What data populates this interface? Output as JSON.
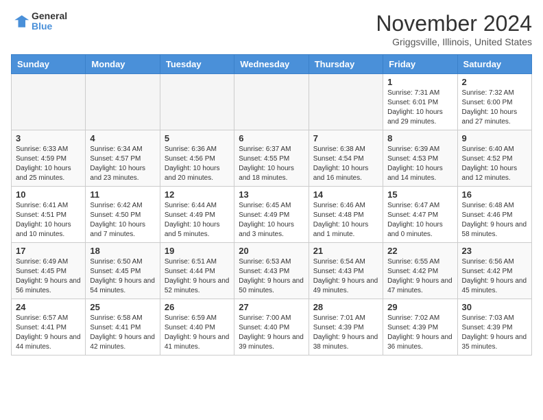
{
  "header": {
    "logo_general": "General",
    "logo_blue": "Blue",
    "month_title": "November 2024",
    "location": "Griggsville, Illinois, United States"
  },
  "weekdays": [
    "Sunday",
    "Monday",
    "Tuesday",
    "Wednesday",
    "Thursday",
    "Friday",
    "Saturday"
  ],
  "weeks": [
    [
      {
        "day": "",
        "info": ""
      },
      {
        "day": "",
        "info": ""
      },
      {
        "day": "",
        "info": ""
      },
      {
        "day": "",
        "info": ""
      },
      {
        "day": "",
        "info": ""
      },
      {
        "day": "1",
        "info": "Sunrise: 7:31 AM\nSunset: 6:01 PM\nDaylight: 10 hours and 29 minutes."
      },
      {
        "day": "2",
        "info": "Sunrise: 7:32 AM\nSunset: 6:00 PM\nDaylight: 10 hours and 27 minutes."
      }
    ],
    [
      {
        "day": "3",
        "info": "Sunrise: 6:33 AM\nSunset: 4:59 PM\nDaylight: 10 hours and 25 minutes."
      },
      {
        "day": "4",
        "info": "Sunrise: 6:34 AM\nSunset: 4:57 PM\nDaylight: 10 hours and 23 minutes."
      },
      {
        "day": "5",
        "info": "Sunrise: 6:36 AM\nSunset: 4:56 PM\nDaylight: 10 hours and 20 minutes."
      },
      {
        "day": "6",
        "info": "Sunrise: 6:37 AM\nSunset: 4:55 PM\nDaylight: 10 hours and 18 minutes."
      },
      {
        "day": "7",
        "info": "Sunrise: 6:38 AM\nSunset: 4:54 PM\nDaylight: 10 hours and 16 minutes."
      },
      {
        "day": "8",
        "info": "Sunrise: 6:39 AM\nSunset: 4:53 PM\nDaylight: 10 hours and 14 minutes."
      },
      {
        "day": "9",
        "info": "Sunrise: 6:40 AM\nSunset: 4:52 PM\nDaylight: 10 hours and 12 minutes."
      }
    ],
    [
      {
        "day": "10",
        "info": "Sunrise: 6:41 AM\nSunset: 4:51 PM\nDaylight: 10 hours and 10 minutes."
      },
      {
        "day": "11",
        "info": "Sunrise: 6:42 AM\nSunset: 4:50 PM\nDaylight: 10 hours and 7 minutes."
      },
      {
        "day": "12",
        "info": "Sunrise: 6:44 AM\nSunset: 4:49 PM\nDaylight: 10 hours and 5 minutes."
      },
      {
        "day": "13",
        "info": "Sunrise: 6:45 AM\nSunset: 4:49 PM\nDaylight: 10 hours and 3 minutes."
      },
      {
        "day": "14",
        "info": "Sunrise: 6:46 AM\nSunset: 4:48 PM\nDaylight: 10 hours and 1 minute."
      },
      {
        "day": "15",
        "info": "Sunrise: 6:47 AM\nSunset: 4:47 PM\nDaylight: 10 hours and 0 minutes."
      },
      {
        "day": "16",
        "info": "Sunrise: 6:48 AM\nSunset: 4:46 PM\nDaylight: 9 hours and 58 minutes."
      }
    ],
    [
      {
        "day": "17",
        "info": "Sunrise: 6:49 AM\nSunset: 4:45 PM\nDaylight: 9 hours and 56 minutes."
      },
      {
        "day": "18",
        "info": "Sunrise: 6:50 AM\nSunset: 4:45 PM\nDaylight: 9 hours and 54 minutes."
      },
      {
        "day": "19",
        "info": "Sunrise: 6:51 AM\nSunset: 4:44 PM\nDaylight: 9 hours and 52 minutes."
      },
      {
        "day": "20",
        "info": "Sunrise: 6:53 AM\nSunset: 4:43 PM\nDaylight: 9 hours and 50 minutes."
      },
      {
        "day": "21",
        "info": "Sunrise: 6:54 AM\nSunset: 4:43 PM\nDaylight: 9 hours and 49 minutes."
      },
      {
        "day": "22",
        "info": "Sunrise: 6:55 AM\nSunset: 4:42 PM\nDaylight: 9 hours and 47 minutes."
      },
      {
        "day": "23",
        "info": "Sunrise: 6:56 AM\nSunset: 4:42 PM\nDaylight: 9 hours and 45 minutes."
      }
    ],
    [
      {
        "day": "24",
        "info": "Sunrise: 6:57 AM\nSunset: 4:41 PM\nDaylight: 9 hours and 44 minutes."
      },
      {
        "day": "25",
        "info": "Sunrise: 6:58 AM\nSunset: 4:41 PM\nDaylight: 9 hours and 42 minutes."
      },
      {
        "day": "26",
        "info": "Sunrise: 6:59 AM\nSunset: 4:40 PM\nDaylight: 9 hours and 41 minutes."
      },
      {
        "day": "27",
        "info": "Sunrise: 7:00 AM\nSunset: 4:40 PM\nDaylight: 9 hours and 39 minutes."
      },
      {
        "day": "28",
        "info": "Sunrise: 7:01 AM\nSunset: 4:39 PM\nDaylight: 9 hours and 38 minutes."
      },
      {
        "day": "29",
        "info": "Sunrise: 7:02 AM\nSunset: 4:39 PM\nDaylight: 9 hours and 36 minutes."
      },
      {
        "day": "30",
        "info": "Sunrise: 7:03 AM\nSunset: 4:39 PM\nDaylight: 9 hours and 35 minutes."
      }
    ]
  ]
}
